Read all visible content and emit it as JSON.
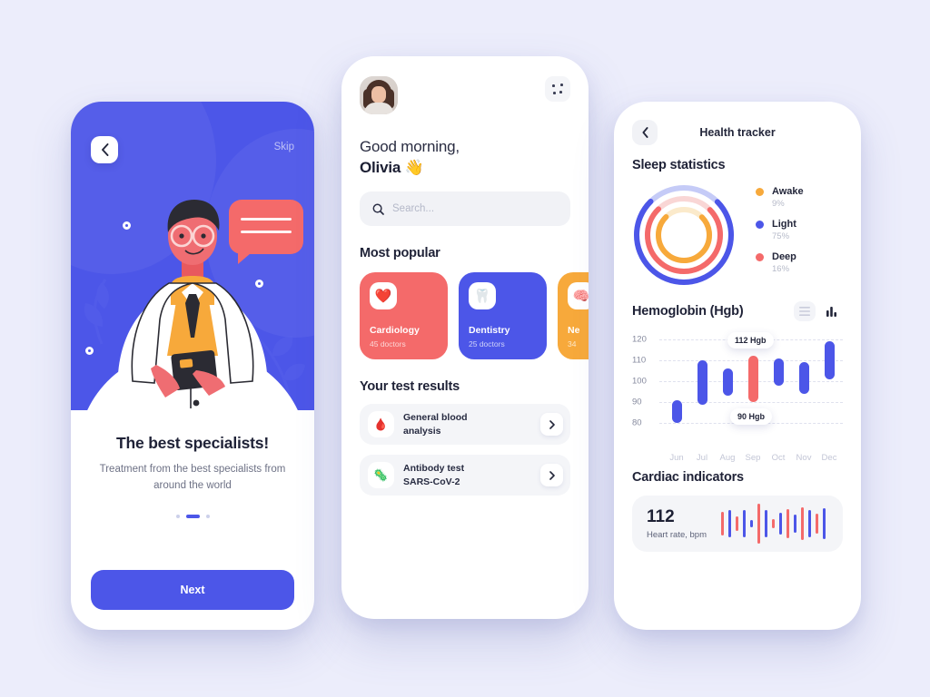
{
  "theme": {
    "background": "#ecedfb",
    "primary_blue": "#4c56e8",
    "coral": "#f46a6a",
    "amber": "#f7a93b",
    "card_grey": "#f4f5f8"
  },
  "onboarding": {
    "back_label": "Back",
    "skip_label": "Skip",
    "title": "The best specialists!",
    "subtitle": "Treatment from the best specialists from around the world",
    "next_label": "Next",
    "pager": {
      "total": 3,
      "active_index": 1
    }
  },
  "home": {
    "greeting_line1": "Good morning,",
    "greeting_line2": "Olivia 👋",
    "avatar_name": "Olivia",
    "menu_label": "More options",
    "search": {
      "value": "",
      "placeholder": "Search..."
    },
    "popular": {
      "title": "Most popular",
      "cards": [
        {
          "name": "Cardiology",
          "count": "45 doctors",
          "icon": "❤️",
          "color": "#f46a6a"
        },
        {
          "name": "Dentistry",
          "count": "25 doctors",
          "icon": "🦷",
          "color": "#4c56e8"
        },
        {
          "name": "Ne",
          "count": "34",
          "icon": "🧠",
          "color": "#f7a93b"
        }
      ]
    },
    "results": {
      "title": "Your test results",
      "items": [
        {
          "line1": "General blood",
          "line2": "analysis",
          "icon": "🩸"
        },
        {
          "line1": "Antibody test",
          "line2": "SARS-CoV-2",
          "icon": "🦠"
        }
      ]
    }
  },
  "tracker": {
    "back_label": "Back",
    "title": "Health tracker",
    "sleep": {
      "title": "Sleep statistics",
      "legend": [
        {
          "label": "Awake",
          "pct": "9%",
          "color": "#f7a93b",
          "value": 9
        },
        {
          "label": "Light",
          "pct": "75%",
          "color": "#4c56e8",
          "value": 75
        },
        {
          "label": "Deep",
          "pct": "16%",
          "color": "#f46a6a",
          "value": 16
        }
      ]
    },
    "hemoglobin": {
      "title": "Hemoglobin (Hgb)",
      "view_list_label": "List view",
      "view_chart_label": "Chart view",
      "active_view": "chart",
      "tooltip_high": "112 Hgb",
      "tooltip_low": "90 Hgb"
    },
    "cardiac": {
      "title": "Cardiac indicators",
      "value": "112",
      "label": "Heart rate, bpm"
    }
  },
  "chart_data": [
    {
      "type": "bar",
      "title": "Hemoglobin (Hgb)",
      "xlabel": "",
      "ylabel": "",
      "ylim": [
        75,
        125
      ],
      "yticks": [
        80,
        90,
        100,
        110,
        120
      ],
      "grid": true,
      "categories": [
        "Jun",
        "Jul",
        "Aug",
        "Sep",
        "Oct",
        "Nov",
        "Dec"
      ],
      "ranges": [
        {
          "category": "Jun",
          "low": 80,
          "high": 91,
          "color": "#4c56e8"
        },
        {
          "category": "Jul",
          "low": 88,
          "high": 110,
          "color": "#4c56e8"
        },
        {
          "category": "Aug",
          "low": 93,
          "high": 106,
          "color": "#4c56e8"
        },
        {
          "category": "Sep",
          "low": 90,
          "high": 112,
          "color": "#f46a6a"
        },
        {
          "category": "Oct",
          "low": 98,
          "high": 111,
          "color": "#4c56e8"
        },
        {
          "category": "Nov",
          "low": 94,
          "high": 109,
          "color": "#4c56e8"
        },
        {
          "category": "Dec",
          "low": 101,
          "high": 119,
          "color": "#4c56e8"
        }
      ],
      "annotations": [
        {
          "text": "112 Hgb",
          "category": "Sep",
          "value": 112
        },
        {
          "text": "90 Hgb",
          "category": "Sep",
          "value": 90
        }
      ]
    },
    {
      "type": "pie",
      "title": "Sleep statistics",
      "legend_position": "right",
      "labels": [
        "Awake",
        "Light",
        "Deep"
      ],
      "values": [
        9,
        75,
        16
      ],
      "colors": [
        "#f7a93b",
        "#4c56e8",
        "#f46a6a"
      ]
    },
    {
      "type": "bar",
      "title": "Heart rate waveform",
      "categories": [
        "1",
        "2",
        "3",
        "4",
        "5",
        "6",
        "7",
        "8",
        "9",
        "10",
        "11",
        "12",
        "13",
        "14",
        "15"
      ],
      "values": [
        26,
        30,
        16,
        30,
        8,
        44,
        30,
        10,
        24,
        32,
        20,
        36,
        30,
        22,
        34
      ],
      "colors": [
        "#f46a6a",
        "#4c56e8",
        "#f46a6a",
        "#4c56e8",
        "#4c56e8",
        "#f46a6a",
        "#4c56e8",
        "#f46a6a",
        "#4c56e8",
        "#f46a6a",
        "#4c56e8",
        "#f46a6a",
        "#4c56e8",
        "#f46a6a",
        "#4c56e8"
      ]
    }
  ]
}
